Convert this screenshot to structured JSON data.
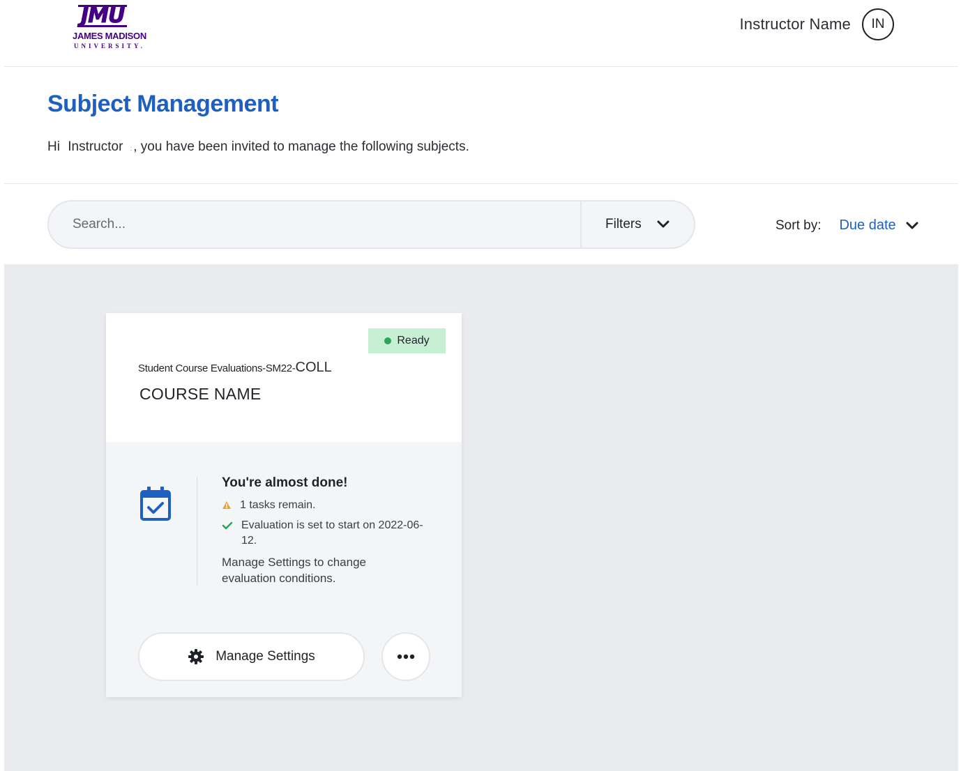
{
  "header": {
    "logo": {
      "mark": "JMU",
      "line1": "JAMES MADISON",
      "line2": "UNIVERSITY."
    },
    "user_name": "Instructor Name",
    "avatar_initials": "IN"
  },
  "intro": {
    "title": "Subject Management",
    "greeting_prefix": "Hi",
    "greeting_name": "Instructor",
    "greeting_sep": ":",
    "greeting_suffix": ", you have been invited to manage the following subjects."
  },
  "toolbar": {
    "search_placeholder": "Search...",
    "filters_label": "Filters",
    "sort_label": "Sort by:",
    "sort_value": "Due date"
  },
  "cards": [
    {
      "status_badge": "Ready",
      "subtitle_prefix": "Student Course Evaluations-SM22-",
      "subtitle_code": "COLL",
      "course_name": "COURSE NAME",
      "progress_title": "You're almost done!",
      "warning_text": "1 tasks remain.",
      "check_text": "Evaluation is set to start on 2022-06-12.",
      "note": "Manage Settings to change evaluation conditions.",
      "manage_button": "Manage Settings"
    }
  ],
  "colors": {
    "brand_purple": "#450084",
    "link_blue": "#1f5fbf",
    "ready_bg": "#c7efd3",
    "ready_dot": "#2aa55a",
    "warning": "#e8a33d",
    "check": "#2aa55a",
    "calendar": "#1f5fbf"
  },
  "icons": [
    "chevron-down-icon",
    "calendar-check-icon",
    "warning-icon",
    "check-icon",
    "gear-icon",
    "more-icon"
  ]
}
